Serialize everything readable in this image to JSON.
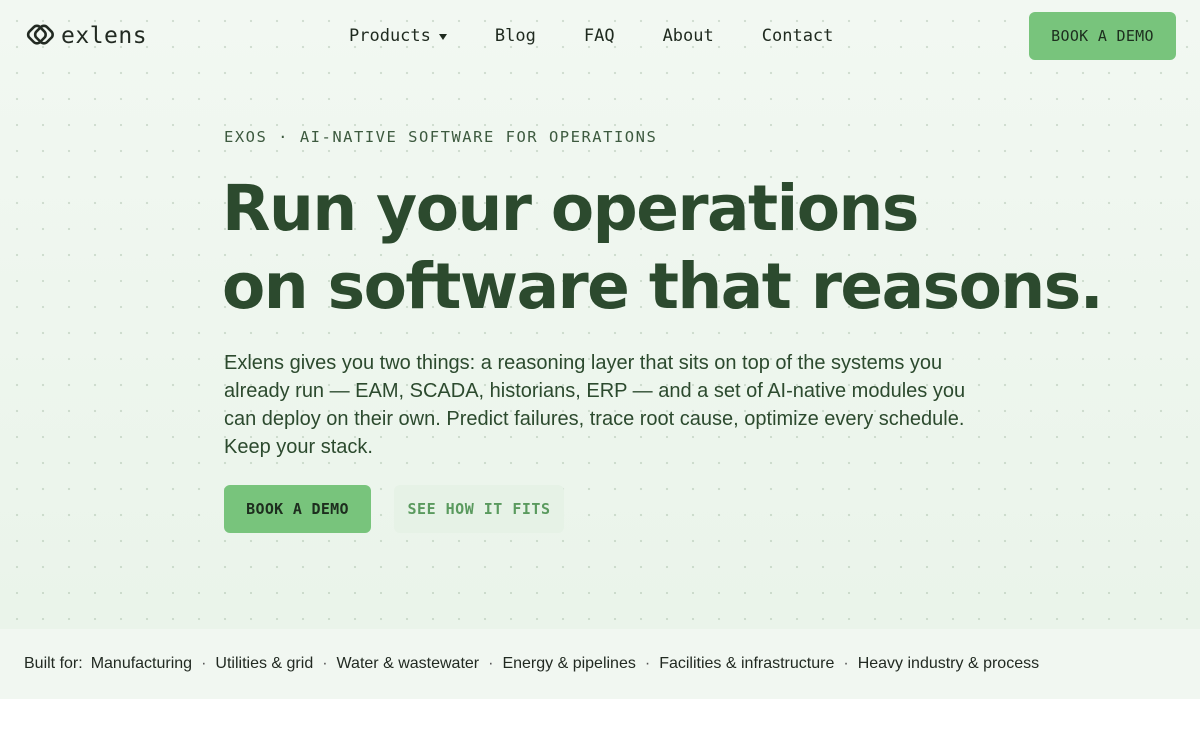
{
  "brand": {
    "name": "exlens",
    "accent": "#78c47c",
    "heading_color": "#2c4a2e"
  },
  "nav": {
    "items": [
      {
        "label": "Products",
        "has_dropdown": true
      },
      {
        "label": "Blog"
      },
      {
        "label": "FAQ"
      },
      {
        "label": "About"
      },
      {
        "label": "Contact"
      }
    ],
    "cta_label": "BOOK A DEMO"
  },
  "hero": {
    "eyebrow": "EXOS · AI-NATIVE SOFTWARE FOR OPERATIONS",
    "headline_line1": "Run your operations",
    "headline_line2": "on software that reasons.",
    "description": "Exlens gives you two things: a reasoning layer that sits on top of the systems you already run — EAM, SCADA, historians, ERP — and a set of AI-native modules you can deploy on their own. Predict failures, trace root cause, optimize every schedule. Keep your stack.",
    "primary_cta": "BOOK A DEMO",
    "secondary_cta": "SEE HOW IT FITS"
  },
  "industries": {
    "label": "Built for:",
    "items": [
      "Manufacturing",
      "Utilities & grid",
      "Water & wastewater",
      "Energy & pipelines",
      "Facilities & infrastructure",
      "Heavy industry & process"
    ],
    "separator": "·"
  }
}
